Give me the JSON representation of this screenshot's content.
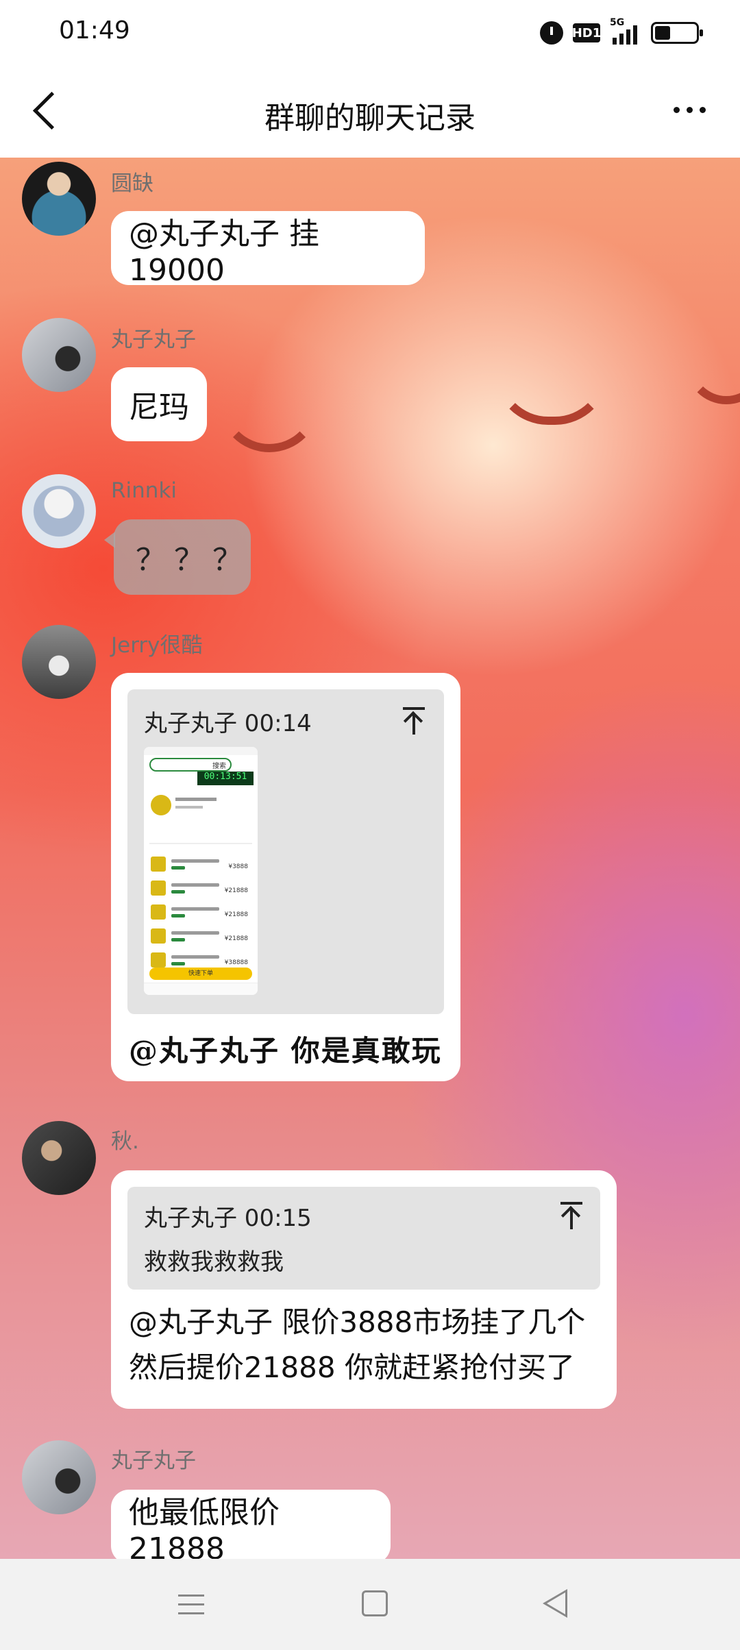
{
  "status_bar": {
    "time": "01:49",
    "hd": "HD1",
    "network": "5G"
  },
  "header": {
    "title": "群聊的聊天记录"
  },
  "messages": [
    {
      "sender": "圆缺",
      "text": "@丸子丸子 挂19000"
    },
    {
      "sender": "丸子丸子",
      "text": "尼玛"
    },
    {
      "sender": "Rinnki",
      "text": "？？？"
    },
    {
      "sender": "Jerry很酷",
      "quote_header": "丸子丸子 00:14",
      "text": "@丸子丸子 你是真敢玩"
    },
    {
      "sender": "秋.",
      "quote_header": "丸子丸子 00:15",
      "quote_text": "救救我救救我",
      "text_line1": "@丸子丸子 限价3888市场挂了几个",
      "text_line2": "然后提价21888 你就赶紧抢付买了"
    },
    {
      "sender": "丸子丸子",
      "text": "他最低限价21888"
    }
  ],
  "embedded_screenshot": {
    "timer": "00:13:51",
    "search_button": "搜索",
    "prices": [
      "¥3888",
      "¥21888",
      "¥21888",
      "¥21888",
      "¥38888"
    ],
    "buy_button": "快速下单"
  }
}
